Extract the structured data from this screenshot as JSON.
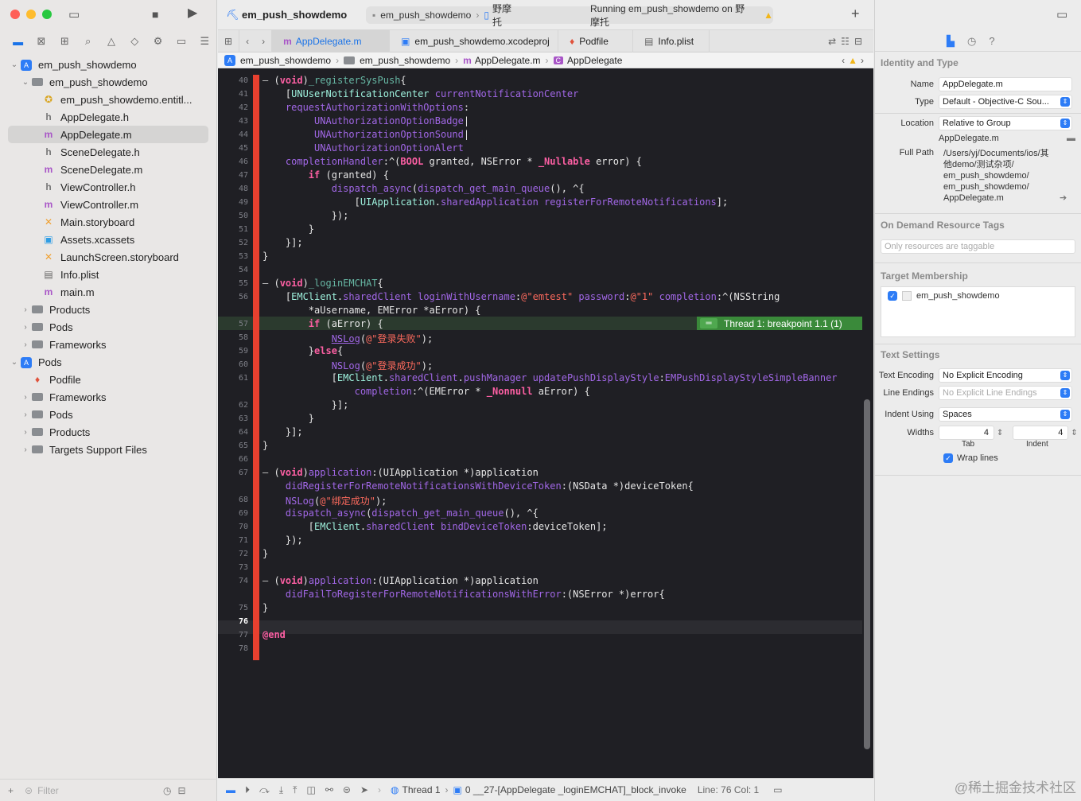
{
  "toolbar": {
    "project_title": "em_push_showdemo",
    "scheme": "em_push_showdemo",
    "device": "野摩托",
    "status": "Running em_push_showdemo on 野摩托",
    "add_label": "+"
  },
  "navigator": {
    "items": [
      {
        "label": "em_push_showdemo"
      },
      {
        "label": "em_push_showdemo"
      },
      {
        "label": "em_push_showdemo.entitl..."
      },
      {
        "label": "AppDelegate.h"
      },
      {
        "label": "AppDelegate.m"
      },
      {
        "label": "SceneDelegate.h"
      },
      {
        "label": "SceneDelegate.m"
      },
      {
        "label": "ViewController.h"
      },
      {
        "label": "ViewController.m"
      },
      {
        "label": "Main.storyboard"
      },
      {
        "label": "Assets.xcassets"
      },
      {
        "label": "LaunchScreen.storyboard"
      },
      {
        "label": "Info.plist"
      },
      {
        "label": "main.m"
      },
      {
        "label": "Products"
      },
      {
        "label": "Pods"
      },
      {
        "label": "Frameworks"
      },
      {
        "label": "Pods"
      },
      {
        "label": "Podfile"
      },
      {
        "label": "Frameworks"
      },
      {
        "label": "Pods"
      },
      {
        "label": "Products"
      },
      {
        "label": "Targets Support Files"
      }
    ],
    "filter_placeholder": "Filter"
  },
  "tabs": [
    {
      "label": "AppDelegate.m"
    },
    {
      "label": "em_push_showdemo.xcodeproj"
    },
    {
      "label": "Podfile"
    },
    {
      "label": "Info.plist"
    }
  ],
  "jumpbar": {
    "items": [
      "em_push_showdemo",
      "em_push_showdemo",
      "AppDelegate.m",
      "AppDelegate"
    ]
  },
  "editor": {
    "breakpoint_label": "Thread 1: breakpoint 1.1 (1)",
    "line_numbers": [
      "40",
      "41",
      "42",
      "43",
      "44",
      "45",
      "46",
      "47",
      "48",
      "49",
      "50",
      "51",
      "52",
      "53",
      "54",
      "55",
      "56",
      "",
      "57",
      "58",
      "59",
      "60",
      "61",
      "",
      "62",
      "63",
      "64",
      "65",
      "66",
      "67",
      "",
      "68",
      "69",
      "70",
      "71",
      "72",
      "73",
      "74",
      "",
      "75",
      "76",
      "77",
      "78"
    ]
  },
  "debugbar": {
    "thread": "Thread 1",
    "frame": "0 __27-[AppDelegate _loginEMCHAT]_block_invoke",
    "position": "Line: 76  Col: 1"
  },
  "inspector": {
    "identity_title": "Identity and Type",
    "name_label": "Name",
    "name_value": "AppDelegate.m",
    "type_label": "Type",
    "type_value": "Default - Objective-C Sou...",
    "location_label": "Location",
    "location_value": "Relative to Group",
    "location_file": "AppDelegate.m",
    "fullpath_label": "Full Path",
    "fullpath_lines": [
      "/Users/yj/Documents/ios/其",
      "他demo/测试杂项/",
      "em_push_showdemo/",
      "em_push_showdemo/",
      "AppDelegate.m"
    ],
    "odr_title": "On Demand Resource Tags",
    "odr_placeholder": "Only resources are taggable",
    "membership_title": "Target Membership",
    "membership_target": "em_push_showdemo",
    "text_settings_title": "Text Settings",
    "encoding_label": "Text Encoding",
    "encoding_value": "No Explicit Encoding",
    "endings_label": "Line Endings",
    "endings_value": "No Explicit Line Endings",
    "indent_label": "Indent Using",
    "indent_value": "Spaces",
    "widths_label": "Widths",
    "tab_width": "4",
    "indent_width": "4",
    "tab_caption": "Tab",
    "indent_caption": "Indent",
    "wrap_label": "Wrap lines"
  },
  "watermark": "@稀土掘金技术社区",
  "colors": {
    "accent": "#2d7cf6",
    "breakpoint": "#e7402f",
    "thread_banner": "#3a8a3a"
  }
}
